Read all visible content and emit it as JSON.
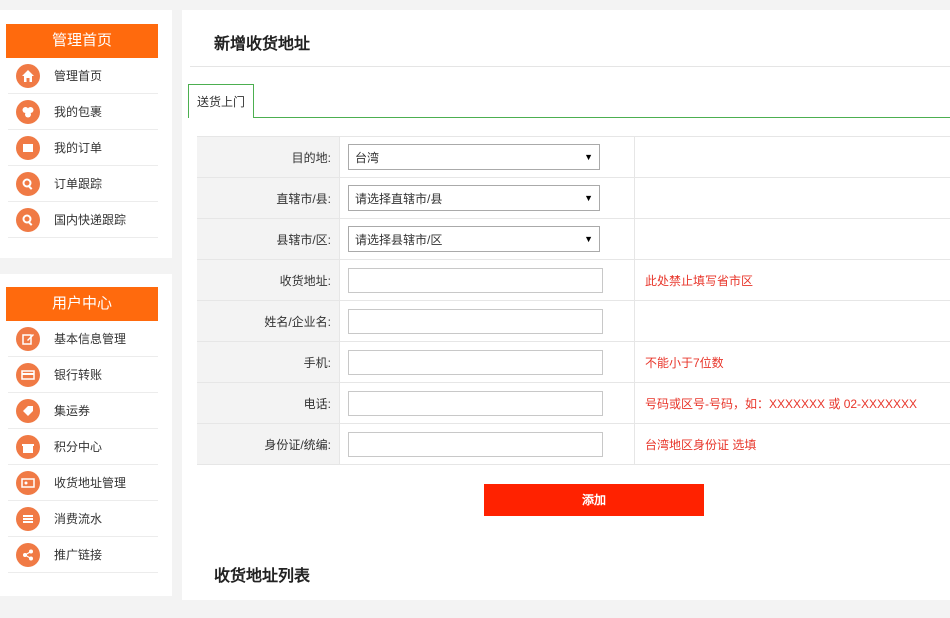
{
  "sidebar": {
    "admin": {
      "header": "管理首页",
      "items": [
        {
          "label": "管理首页",
          "icon": "home-icon"
        },
        {
          "label": "我的包裹",
          "icon": "package-icon"
        },
        {
          "label": "我的订单",
          "icon": "order-icon"
        },
        {
          "label": "订单跟踪",
          "icon": "search-icon"
        },
        {
          "label": "国内快递跟踪",
          "icon": "search-icon"
        }
      ]
    },
    "user": {
      "header": "用户中心",
      "items": [
        {
          "label": "基本信息管理",
          "icon": "edit-icon"
        },
        {
          "label": "银行转账",
          "icon": "credit-card-icon"
        },
        {
          "label": "集运券",
          "icon": "tag-icon"
        },
        {
          "label": "积分中心",
          "icon": "gift-icon"
        },
        {
          "label": "收货地址管理",
          "icon": "address-card-icon"
        },
        {
          "label": "消费流水",
          "icon": "list-icon"
        },
        {
          "label": "推广链接",
          "icon": "share-icon"
        }
      ]
    }
  },
  "main": {
    "title": "新增收货地址",
    "tab": "送货上门",
    "form": {
      "destination": {
        "label": "目的地:",
        "value": "台湾"
      },
      "city": {
        "label": "直辖市/县:",
        "value": "请选择直辖市/县"
      },
      "district": {
        "label": "县辖市/区:",
        "value": "请选择县辖市/区"
      },
      "address": {
        "label": "收货地址:",
        "value": "",
        "tip": "此处禁止填写省市区"
      },
      "name": {
        "label": "姓名/企业名:",
        "value": ""
      },
      "mobile": {
        "label": "手机:",
        "value": "",
        "tip": "不能小于7位数"
      },
      "phone": {
        "label": "电话:",
        "value": "",
        "tip": "号码或区号-号码，如：XXXXXXX 或 02-XXXXXXX"
      },
      "idcard": {
        "label": "身份证/统编:",
        "value": "",
        "tip": "台湾地区身份证 选填"
      }
    },
    "add_button": "添加",
    "list_title": "收货地址列表"
  },
  "colors": {
    "accent": "#ff6a0d",
    "icon_bg": "#f07a45",
    "tip": "#e8352a",
    "button": "#ff2200",
    "tab_border": "#4caf50"
  }
}
